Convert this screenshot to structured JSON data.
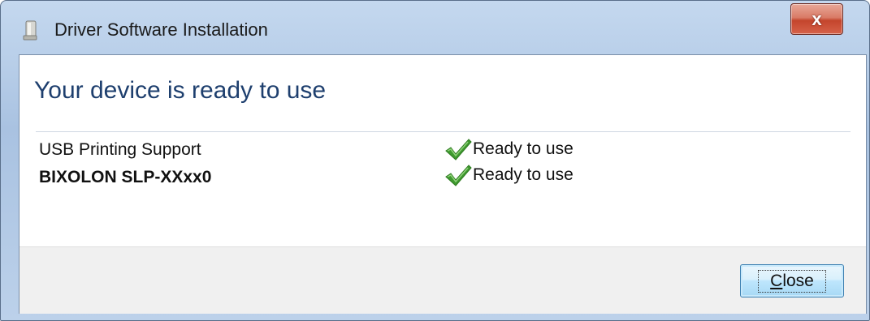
{
  "window": {
    "title": "Driver Software Installation",
    "icon": "device-installer-icon",
    "close_glyph": "x"
  },
  "main": {
    "heading": "Your device is ready to use",
    "devices": [
      {
        "name": "USB Printing Support",
        "status": "Ready to use",
        "status_icon": "green-checkmark-icon"
      },
      {
        "name": "BIXOLON  SLP-XXxx0",
        "status": "Ready to use",
        "status_icon": "green-checkmark-icon"
      }
    ]
  },
  "footer": {
    "close_label": "Close"
  },
  "colors": {
    "heading": "#1e3f6e",
    "check": "#3f9a2f"
  }
}
